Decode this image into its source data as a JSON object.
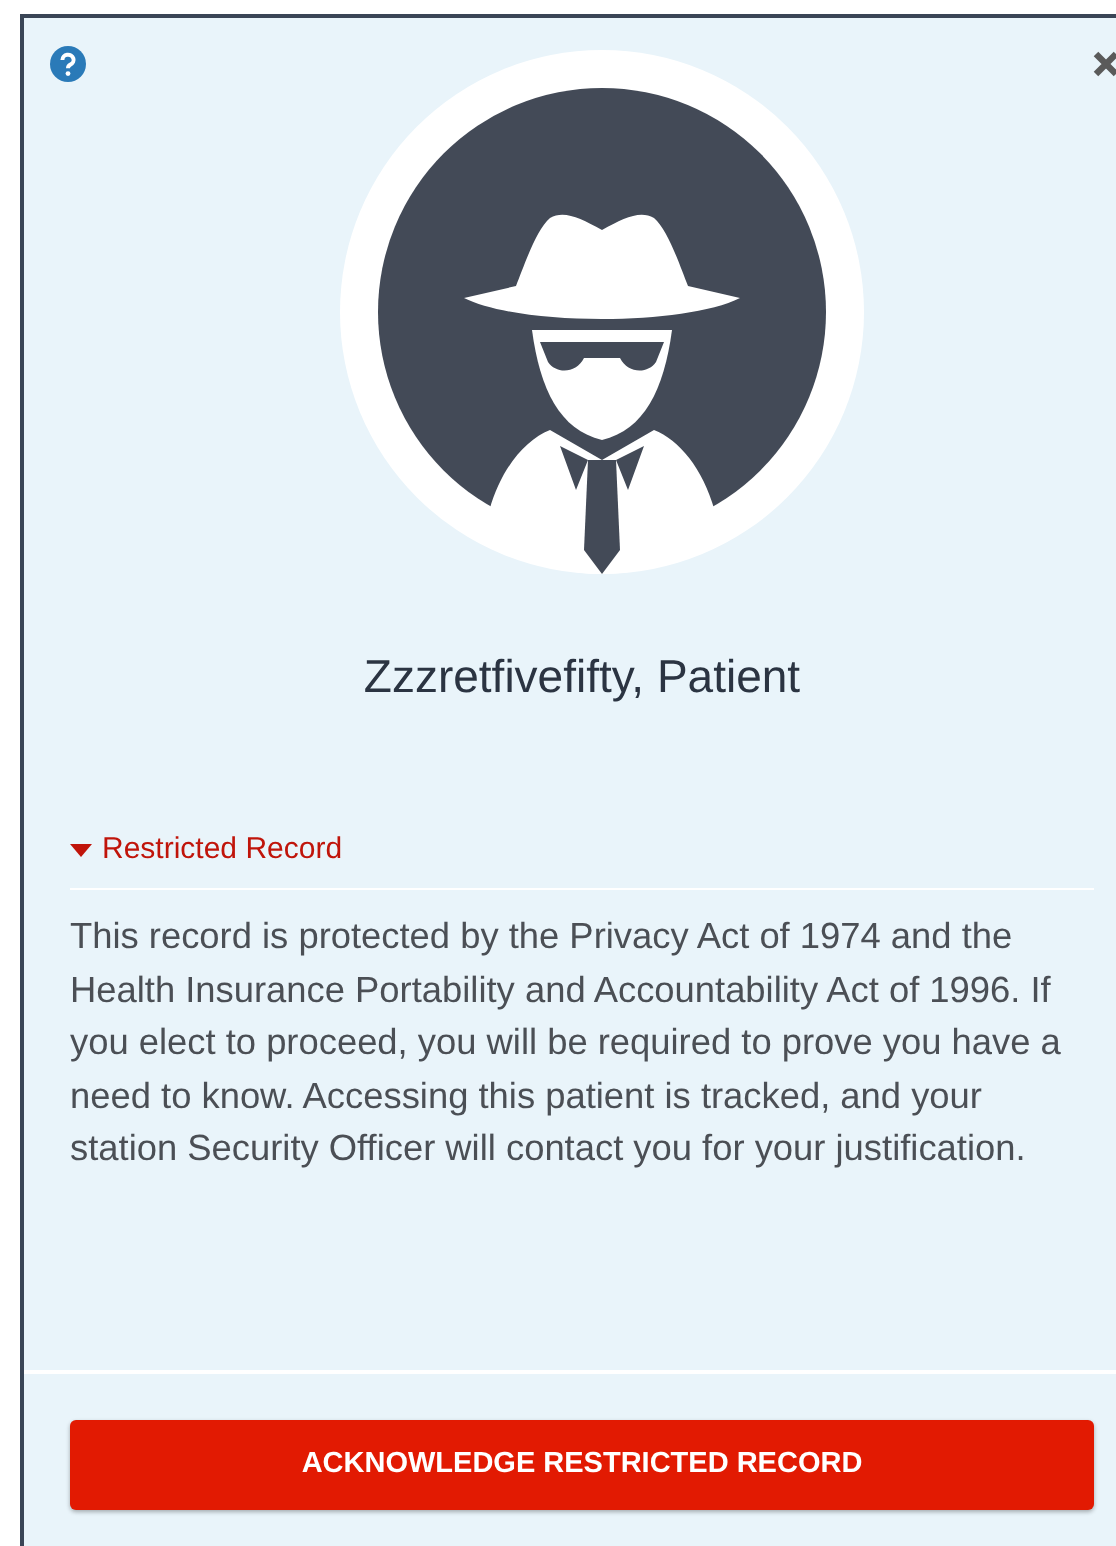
{
  "patient": {
    "name": "Zzzretfivefifty, Patient"
  },
  "section": {
    "title": "Restricted Record",
    "expanded": true,
    "text": "This record is protected by the Privacy Act of 1974 and the Health Insurance Portability and Accountability Act of 1996. If you elect to proceed, you will be required to prove you have a need to know. Accessing this patient is tracked, and your station Security Officer will contact you for your justification."
  },
  "buttons": [
    "ACKNOWLEDGE RESTRICTED RECORD"
  ]
}
